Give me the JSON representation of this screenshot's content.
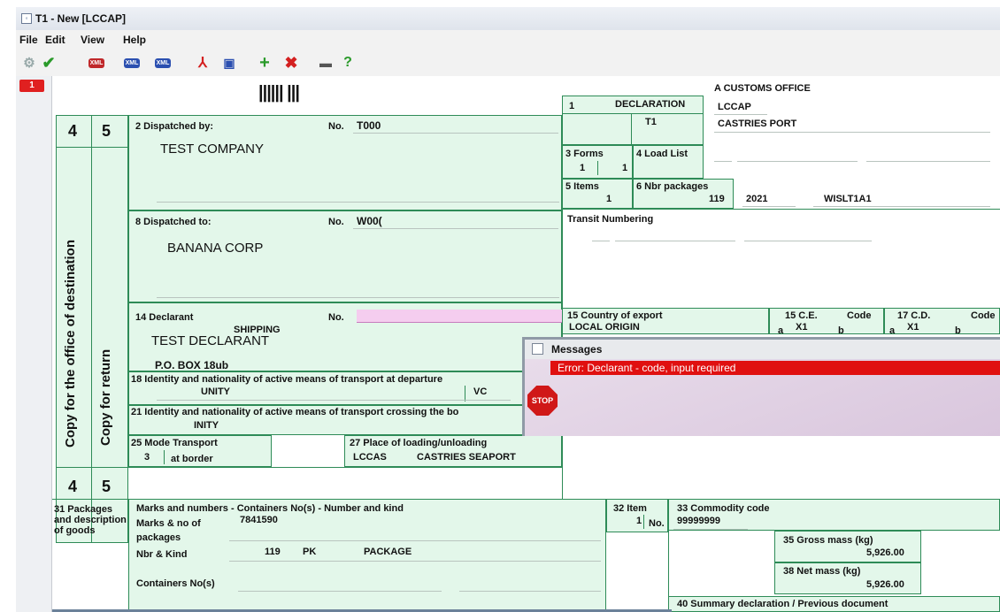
{
  "window": {
    "title": "T1 - New [LCCAP]"
  },
  "menu": [
    "File",
    "Edit",
    "View",
    "Help"
  ],
  "toolbar": {
    "xml_label": "XML"
  },
  "page_tab": "1",
  "barcode": "|||||| |||",
  "copy_numbers": {
    "left": "4",
    "right": "5"
  },
  "side_text": {
    "destination": "Copy for the office of destination",
    "return": "Copy for return"
  },
  "box2": {
    "label": "2 Dispatched by:",
    "no_label": "No.",
    "no_value": "T000",
    "name": "TEST COMPANY"
  },
  "box8": {
    "label": "8 Dispatched to:",
    "no_label": "No.",
    "no_value": "W00(",
    "name": "BANANA CORP"
  },
  "box14": {
    "label": "14 Declarant",
    "no_label": "No.",
    "shipping": "SHIPPING",
    "name": "TEST DECLARANT",
    "address": "P.O. BOX 18ub"
  },
  "box18": {
    "label": "18 Identity and nationality of active means of transport at departure",
    "value": "UNITY",
    "nat": "VC"
  },
  "box21": {
    "label": "21 Identity and nationality of active means of transport crossing the bo",
    "value": "INITY"
  },
  "box25": {
    "label": "25 Mode Transport",
    "value": "3",
    "sub": "at border"
  },
  "box27": {
    "label": "27 Place of loading/unloading",
    "code": "LCCAS",
    "name": "CASTRIES SEAPORT"
  },
  "customs_office": {
    "label": "A CUSTOMS OFFICE",
    "code": "LCCAP",
    "name": "CASTRIES PORT"
  },
  "box1": {
    "label": "1",
    "decl_label": "DECLARATION",
    "decl_value": "T1"
  },
  "box3": {
    "label": "3 Forms",
    "a": "1",
    "b": "1"
  },
  "box4": {
    "label": "4 Load List"
  },
  "box5": {
    "label": "5 Items",
    "value": "1"
  },
  "box6": {
    "label": "6 Nbr packages",
    "value": "119"
  },
  "ref": {
    "year": "2021",
    "code": "WISLT1A1"
  },
  "transit": {
    "label": "Transit Numbering"
  },
  "box15": {
    "label": "15 Country of export",
    "value": "LOCAL ORIGIN"
  },
  "box15ce": {
    "label": "15 C.E.",
    "code_label": "Code",
    "a": "a",
    "value": "X1",
    "b": "b"
  },
  "box17cd": {
    "label": "17 C.D.",
    "code_label": "Code",
    "a": "a",
    "value": "X1",
    "b": "b"
  },
  "box31": {
    "label": "31 Packages and description of goods",
    "header": "Marks and numbers - Containers No(s) - Number and kind",
    "marks_label": "Marks & no of packages",
    "marks_value": "7841590",
    "nbr_label": "Nbr & Kind",
    "nbr_value": "119",
    "kind_code": "PK",
    "kind_name": "PACKAGE",
    "containers_label": "Containers No(s)"
  },
  "box32": {
    "label": "32 Item",
    "value": "1",
    "no_label": "No."
  },
  "box33": {
    "label": "33 Commodity code",
    "value": "99999999"
  },
  "box35": {
    "label": "35 Gross mass (kg)",
    "value": "5,926.00"
  },
  "box38": {
    "label": "38 Net mass (kg)",
    "value": "5,926.00"
  },
  "box40": {
    "label": "40 Summary declaration / Previous document"
  },
  "messages": {
    "title": "Messages",
    "error": "Error: Declarant - code, input required",
    "stop": "STOP"
  },
  "colors": {
    "form_bg": "#e3f7ea",
    "form_border": "#2e8b57",
    "error": "#e01010",
    "declarant_no": "#f5cdef"
  }
}
